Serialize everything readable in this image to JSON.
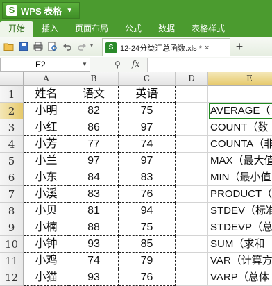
{
  "app": {
    "title": "WPS 表格",
    "logo": "S",
    "dropdown_icon": "caret-down-icon"
  },
  "ribbon": {
    "tabs": [
      "开始",
      "插入",
      "页面布局",
      "公式",
      "数据",
      "表格样式"
    ],
    "active_tab": "开始"
  },
  "toolbar": {
    "icons": [
      "open-folder-icon",
      "save-icon",
      "print-icon",
      "preview-icon",
      "undo-icon",
      "redo-icon"
    ],
    "document_tab": {
      "name": "12-24分类汇总函数.xls *",
      "close": "×"
    },
    "new_tab": "+"
  },
  "formula_bar": {
    "cell_ref": "E2",
    "zoom_icon": "magnifier-icon",
    "fx": "fx",
    "value": ""
  },
  "grid": {
    "columns": [
      "A",
      "B",
      "C",
      "D",
      "E"
    ],
    "selected_column": "E",
    "rows": [
      "1",
      "2",
      "3",
      "4",
      "5",
      "6",
      "7",
      "8",
      "9",
      "10",
      "11",
      "12"
    ],
    "selected_row": "2",
    "header": [
      "姓名",
      "语文",
      "英语",
      "",
      ""
    ],
    "data": [
      [
        "小明",
        "82",
        "75",
        "",
        "AVERAGE（"
      ],
      [
        "小红",
        "86",
        "97",
        "",
        "COUNT（数"
      ],
      [
        "小芳",
        "77",
        "74",
        "",
        "COUNTA（非"
      ],
      [
        "小兰",
        "97",
        "97",
        "",
        "MAX（最大值"
      ],
      [
        "小东",
        "84",
        "83",
        "",
        "MIN（最小值"
      ],
      [
        "小溪",
        "83",
        "76",
        "",
        "PRODUCT（"
      ],
      [
        "小贝",
        "81",
        "94",
        "",
        "STDEV（标准"
      ],
      [
        "小楠",
        "88",
        "75",
        "",
        "STDEVP（总"
      ],
      [
        "小钟",
        "93",
        "85",
        "",
        "SUM（求和"
      ],
      [
        "小鸡",
        "74",
        "79",
        "",
        "VAR（计算方"
      ],
      [
        "小猫",
        "93",
        "76",
        "",
        "VARP（总体"
      ]
    ]
  }
}
